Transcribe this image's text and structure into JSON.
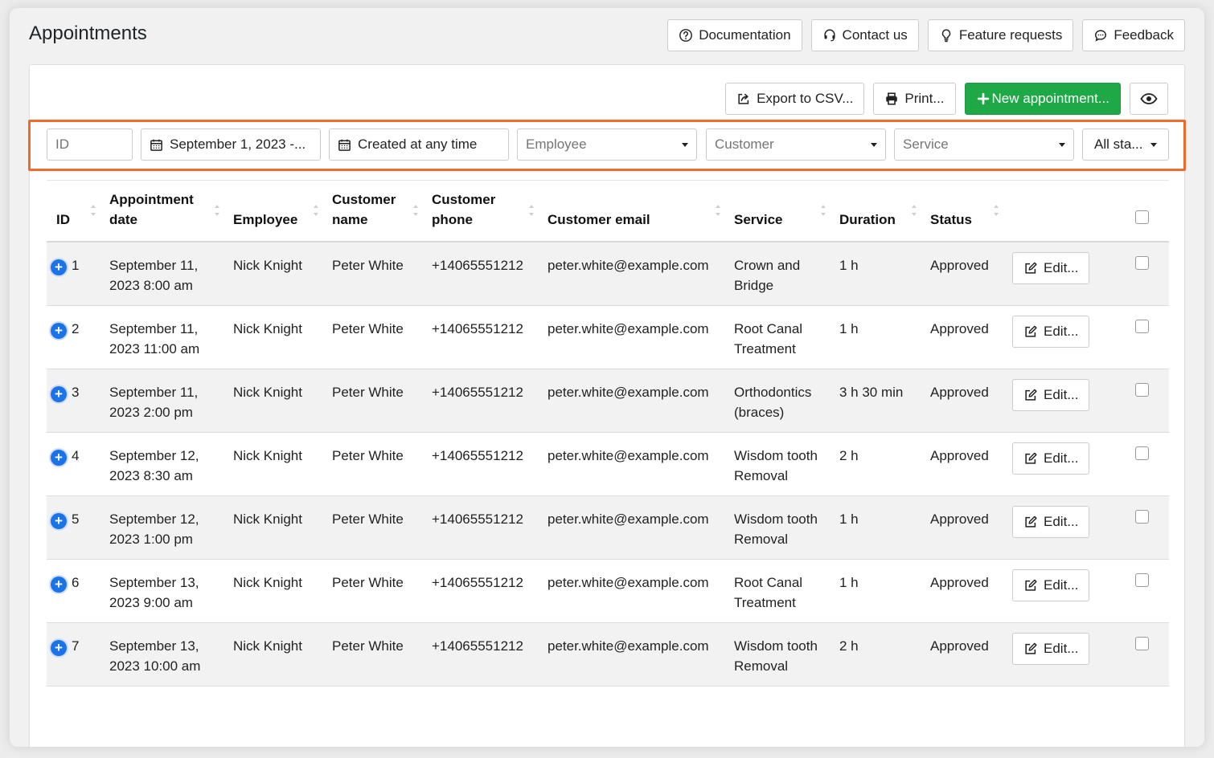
{
  "page": {
    "title": "Appointments"
  },
  "help_bar": {
    "documentation": "Documentation",
    "contact": "Contact us",
    "feature_requests": "Feature requests",
    "feedback": "Feedback"
  },
  "toolbar": {
    "export": "Export to CSV...",
    "print": "Print...",
    "new_appointment": "New appointment..."
  },
  "filters": {
    "id_placeholder": "ID",
    "date_range": "September 1, 2023 -...",
    "created": "Created at any time",
    "employee": "Employee",
    "customer": "Customer",
    "service": "Service",
    "status": "All sta..."
  },
  "table": {
    "headers": {
      "id": "ID",
      "appointment_date": "Appointment date",
      "employee": "Employee",
      "customer_name": "Customer name",
      "customer_phone": "Customer phone",
      "customer_email": "Customer email",
      "service": "Service",
      "duration": "Duration",
      "status": "Status"
    },
    "edit_label": "Edit...",
    "rows": [
      {
        "id": "1",
        "date": "September 11, 2023 8:00 am",
        "employee": "Nick Knight",
        "customer": "Peter White",
        "phone": "+14065551212",
        "email": "peter.white@example.com",
        "service": "Crown and Bridge",
        "duration": "1 h",
        "status": "Approved"
      },
      {
        "id": "2",
        "date": "September 11, 2023 11:00 am",
        "employee": "Nick Knight",
        "customer": "Peter White",
        "phone": "+14065551212",
        "email": "peter.white@example.com",
        "service": "Root Canal Treatment",
        "duration": "1 h",
        "status": "Approved"
      },
      {
        "id": "3",
        "date": "September 11, 2023 2:00 pm",
        "employee": "Nick Knight",
        "customer": "Peter White",
        "phone": "+14065551212",
        "email": "peter.white@example.com",
        "service": "Orthodontics (braces)",
        "duration": "3 h 30 min",
        "status": "Approved"
      },
      {
        "id": "4",
        "date": "September 12, 2023 8:30 am",
        "employee": "Nick Knight",
        "customer": "Peter White",
        "phone": "+14065551212",
        "email": "peter.white@example.com",
        "service": "Wisdom tooth Removal",
        "duration": "2 h",
        "status": "Approved"
      },
      {
        "id": "5",
        "date": "September 12, 2023 1:00 pm",
        "employee": "Nick Knight",
        "customer": "Peter White",
        "phone": "+14065551212",
        "email": "peter.white@example.com",
        "service": "Wisdom tooth Removal",
        "duration": "1 h",
        "status": "Approved"
      },
      {
        "id": "6",
        "date": "September 13, 2023 9:00 am",
        "employee": "Nick Knight",
        "customer": "Peter White",
        "phone": "+14065551212",
        "email": "peter.white@example.com",
        "service": "Root Canal Treatment",
        "duration": "1 h",
        "status": "Approved"
      },
      {
        "id": "7",
        "date": "September 13, 2023 10:00 am",
        "employee": "Nick Knight",
        "customer": "Peter White",
        "phone": "+14065551212",
        "email": "peter.white@example.com",
        "service": "Wisdom tooth Removal",
        "duration": "2 h",
        "status": "Approved"
      }
    ]
  },
  "colors": {
    "primary": "#1fa846",
    "highlight": "#f1692b",
    "expand": "#1a73e8"
  },
  "icons": {
    "documentation": "question-circle-icon",
    "contact": "headset-icon",
    "feature_requests": "lightbulb-icon",
    "feedback": "speech-bubble-icon",
    "export": "share-icon",
    "print": "printer-icon",
    "new": "plus-icon",
    "visibility": "eye-icon",
    "calendar": "calendar-icon",
    "edit": "edit-icon"
  }
}
